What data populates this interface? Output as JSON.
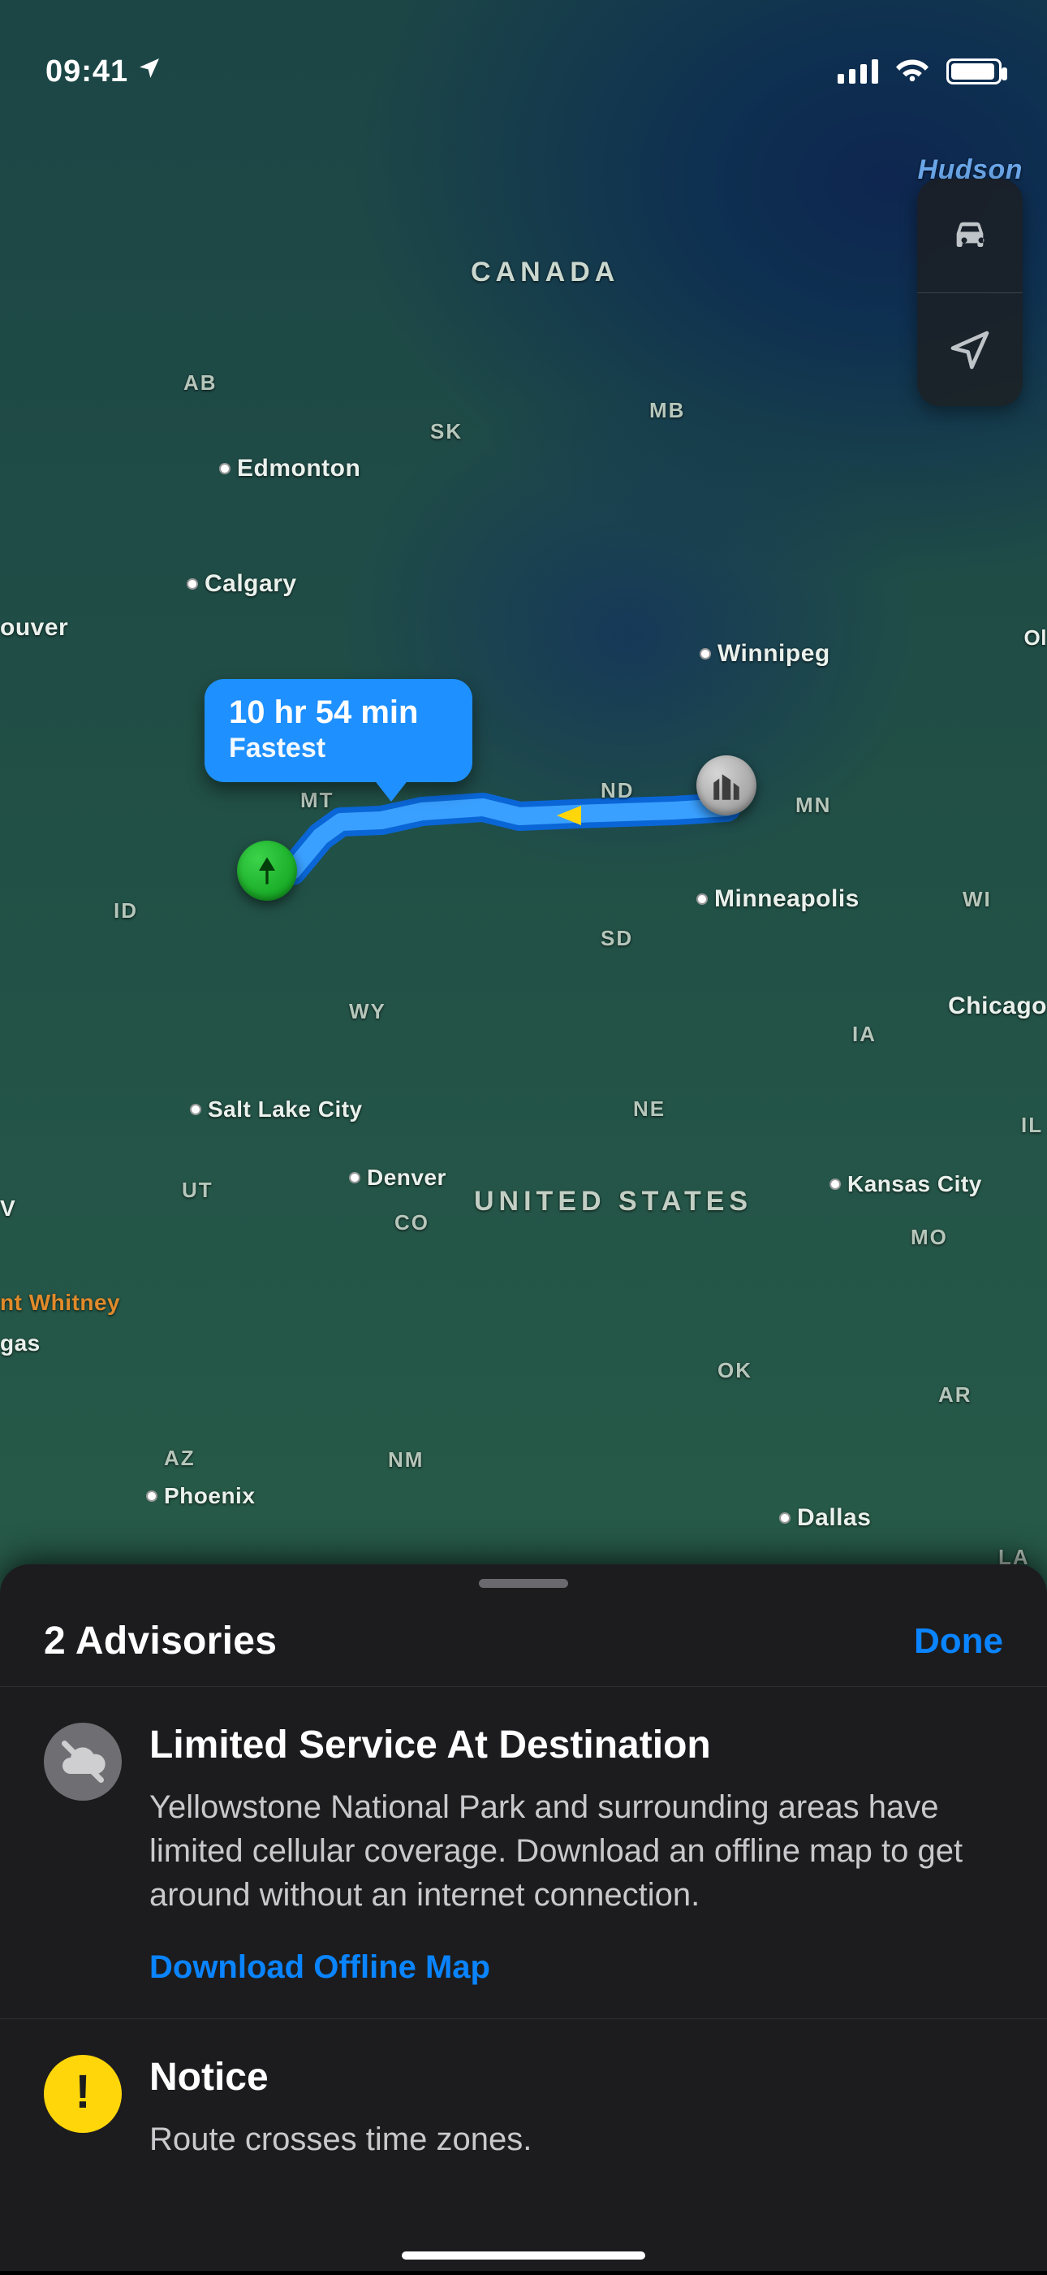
{
  "status": {
    "time": "09:41"
  },
  "map": {
    "countries": {
      "canada": "CANADA",
      "usa": "UNITED STATES"
    },
    "hudson": "Hudson",
    "provinces": {
      "ab": "AB",
      "sk": "SK",
      "mb": "MB"
    },
    "states": {
      "mt": "MT",
      "nd": "ND",
      "mn": "MN",
      "id": "ID",
      "sd": "SD",
      "wy": "WY",
      "wi": "WI",
      "ia": "IA",
      "ne": "NE",
      "il": "IL",
      "ut": "UT",
      "co": "CO",
      "ok": "OK",
      "ar": "AR",
      "az": "AZ",
      "nm": "NM",
      "mo": "MO",
      "la": "LA"
    },
    "cities": {
      "edmonton": "Edmonton",
      "calgary": "Calgary",
      "vancouver": "ouver",
      "winnipeg": "Winnipeg",
      "minneapolis": "Minneapolis",
      "chicago": "Chicago",
      "slc": "Salt Lake City",
      "denver": "Denver",
      "kc": "Kansas City",
      "phoenix": "Phoenix",
      "dallas": "Dallas",
      "ol": "Ol"
    },
    "pois": {
      "whitney": "nt Whitney",
      "vegas": "gas",
      "v": "V"
    }
  },
  "route": {
    "duration": "10 hr 54 min",
    "tag": "Fastest"
  },
  "sheet": {
    "title": "2 Advisories",
    "done": "Done",
    "adv1": {
      "title": "Limited Service At Destination",
      "body": "Yellowstone National Park and surrounding areas have limited cellular coverage. Download an offline map to get around without an internet connection.",
      "link": "Download Offline Map"
    },
    "adv2": {
      "title": "Notice",
      "body": "Route crosses time zones."
    }
  }
}
